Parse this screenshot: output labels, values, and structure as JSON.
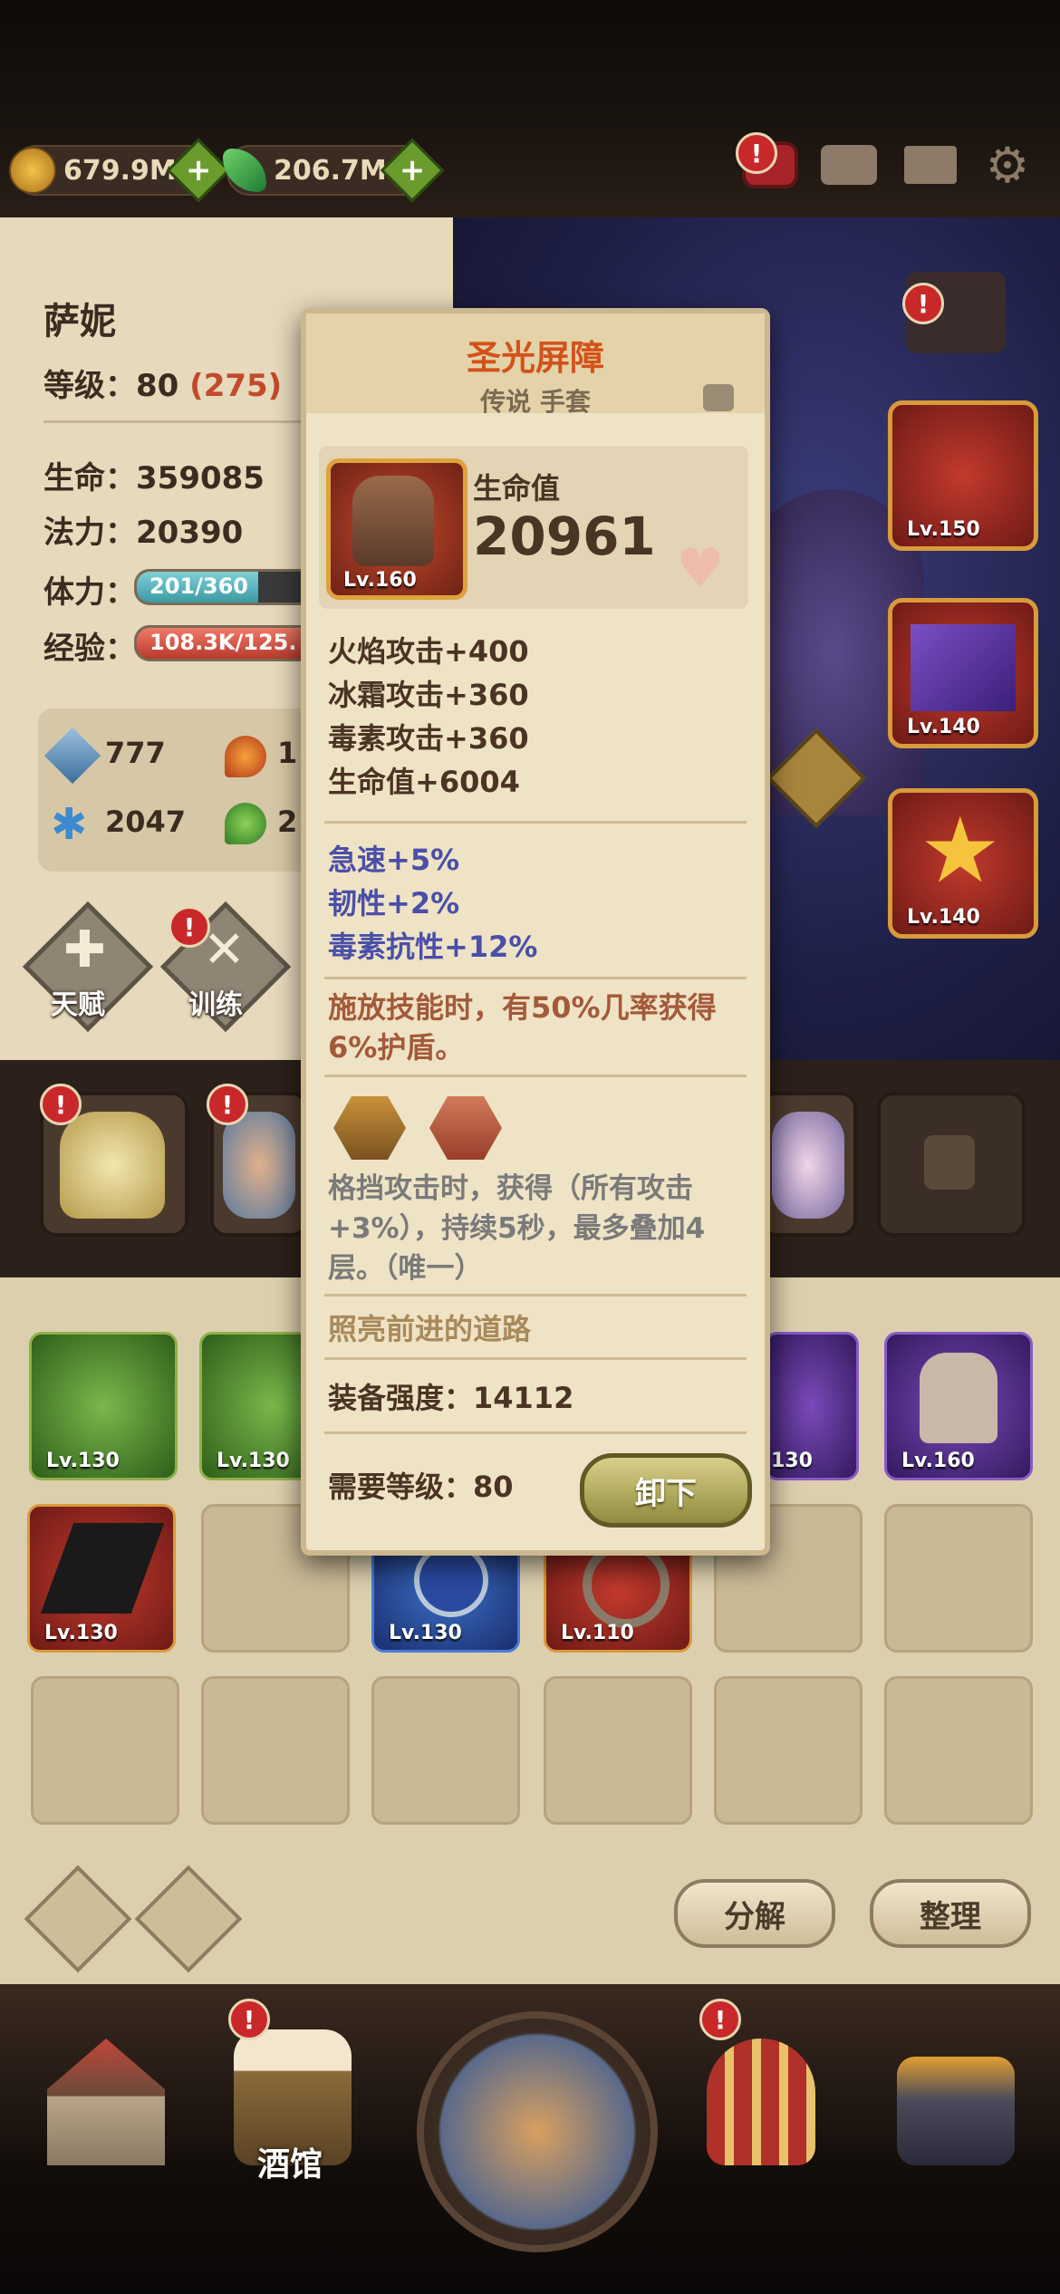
{
  "currencies": {
    "gold": "679.9M",
    "gems": "206.7M"
  },
  "hero": {
    "name": "萨妮",
    "level_label": "等级：80",
    "level_extra": "(275)",
    "hp": "生命：359085",
    "mana": "法力：20390",
    "stamina_label": "体力：",
    "stamina_value": "201/360",
    "stamina_fraction": 0.56,
    "exp_label": "经验：",
    "exp_value": "108.3K/125.",
    "exp_fraction": 0.86,
    "attr_sword": "777",
    "attr_snow": "2047",
    "attr_fire_partial": "1",
    "attr_green_partial": "2",
    "talent_label": "天赋",
    "train_label": "训练"
  },
  "equip_slots": {
    "lv150": "Lv.150",
    "lv140a": "Lv.140",
    "lv140b": "Lv.140"
  },
  "inventory": {
    "row1": [
      "Lv.130",
      "Lv.130",
      "130",
      "Lv.160"
    ],
    "row2": [
      "Lv.130",
      "Lv.130",
      "Lv.110"
    ],
    "decompose_label": "分解",
    "sort_label": "整理"
  },
  "tooltip": {
    "title": "圣光屏障",
    "subtitle": "传说 手套",
    "item_level": "Lv.160",
    "main_stat_label": "生命值",
    "main_stat_value": "20961",
    "base_stats": [
      "火焰攻击+400",
      "冰霜攻击+360",
      "毒素攻击+360",
      "生命值+6004"
    ],
    "bonus_stats": [
      "急速+5%",
      "韧性+2%",
      "毒素抗性+12%"
    ],
    "skill_effect": "施放技能时，有50%几率获得6%护盾。",
    "set_effect": "格挡攻击时，获得（所有攻击+3%），持续5秒，最多叠加4层。（唯一）",
    "flavor": "照亮前进的道路",
    "power": "装备强度：14112",
    "required_level": "需要等级：80",
    "unequip_label": "卸下"
  },
  "nav": {
    "tavern_label": "酒馆"
  },
  "colors": {
    "title_orange": "#d2531a",
    "stat_text": "#4a3424",
    "bonus_blue": "#4a4fa8",
    "effect_brown": "#a35a3a",
    "badge_red": "#c8282a"
  }
}
